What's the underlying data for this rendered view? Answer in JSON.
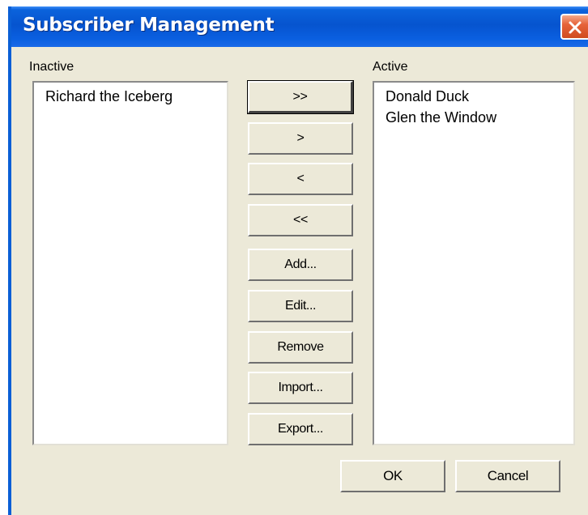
{
  "window": {
    "title": "Subscriber Management"
  },
  "inactive": {
    "label": "Inactive",
    "items": [
      "Richard the Iceberg"
    ]
  },
  "active": {
    "label": "Active",
    "items": [
      "Donald Duck",
      "Glen the Window"
    ]
  },
  "buttons": {
    "move_all_right": ">>",
    "move_right": ">",
    "move_left": "<",
    "move_all_left": "<<",
    "add": "Add...",
    "edit": "Edit...",
    "remove": "Remove",
    "import": "Import...",
    "export": "Export...",
    "ok": "OK",
    "cancel": "Cancel"
  }
}
